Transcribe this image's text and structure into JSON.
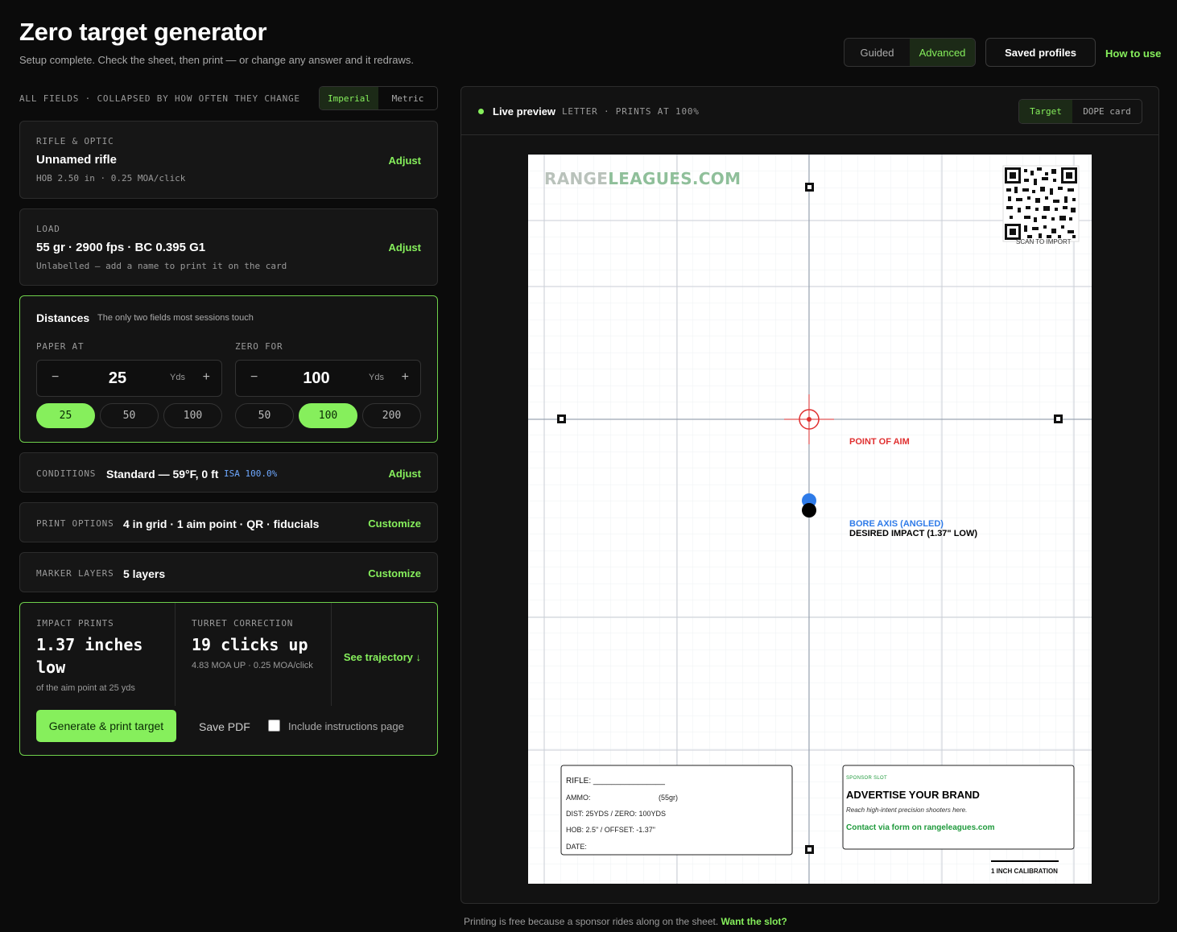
{
  "header": {
    "title": "Zero target generator",
    "subtitle": "Setup complete. Check the sheet, then print — or change any answer and it redraws.",
    "modes": [
      "Guided",
      "Advanced"
    ],
    "active_mode": "Advanced",
    "saved_profiles_label": "Saved profiles",
    "how_to_label": "How to use"
  },
  "fields_header": {
    "caption": "ALL FIELDS · COLLAPSED BY HOW OFTEN THEY CHANGE",
    "units": [
      "Imperial",
      "Metric"
    ],
    "active_unit": "Imperial"
  },
  "rifle": {
    "label": "RIFLE & OPTIC",
    "name": "Unnamed rifle",
    "details": "HOB 2.50 in · 0.25 MOA/click",
    "action": "Adjust"
  },
  "load": {
    "label": "LOAD",
    "summary": "55 gr · 2900 fps · BC 0.395 G1",
    "details": "Unlabelled — add a name to print it on the card",
    "action": "Adjust"
  },
  "distances": {
    "title": "Distances",
    "hint": "The only two fields most sessions touch",
    "paper_at": {
      "label": "PAPER AT",
      "minus": "−",
      "value": "25",
      "unit": "Yds",
      "plus": "+",
      "presets": [
        "25",
        "50",
        "100"
      ],
      "active": "25"
    },
    "zero_for": {
      "label": "ZERO FOR",
      "minus": "−",
      "value": "100",
      "unit": "Yds",
      "plus": "+",
      "presets": [
        "50",
        "100",
        "200"
      ],
      "active": "100"
    }
  },
  "conditions": {
    "label": "CONDITIONS",
    "value": "Standard — 59°F, 0 ft",
    "badge": "ISA 100.0%",
    "badge_color": "#6ea8ff",
    "action": "Adjust"
  },
  "print_options": {
    "label": "PRINT OPTIONS",
    "value": "4 in grid · 1 aim point · QR · fiducials",
    "action": "Customize"
  },
  "marker_layers": {
    "label": "MARKER LAYERS",
    "value": "5 layers",
    "action": "Customize"
  },
  "results": {
    "impact_label": "IMPACT PRINTS",
    "impact_line1": "1.37 inches",
    "impact_line2": "low",
    "impact_note": "of the aim point at 25 yds",
    "turret_label": "TURRET CORRECTION",
    "turret_value": "19 clicks up",
    "turret_note": "4.83 MOA UP · 0.25 MOA/click",
    "trajectory_link": "See trajectory ↓",
    "generate_label": "Generate & print target",
    "save_pdf_label": "Save PDF",
    "include_instructions_label": "Include instructions page",
    "include_instructions_checked": false
  },
  "preview": {
    "live_label": "Live preview",
    "paper_label": "LETTER · PRINTS AT 100%",
    "views": [
      "Target",
      "DOPE card"
    ],
    "active_view": "Target"
  },
  "sheet": {
    "brand_part1": "RANGE",
    "brand_part2": "LEAGUES.COM",
    "qr_caption": "SCAN TO IMPORT",
    "poa_label": "POINT OF AIM",
    "bore_label": "BORE AXIS (ANGLED)",
    "impact_label": "DESIRED IMPACT (1.37\" LOW)",
    "card_rifle": "RIFLE: ________________",
    "card_ammo": "AMMO:",
    "card_ammo_value": "(55gr)",
    "card_dist": "DIST: 25YDS / ZERO: 100YDS",
    "card_hob": "HOB: 2.5\" / OFFSET: -1.37\"",
    "card_date": "DATE:",
    "sponsor_tag": "SPONSOR SLOT",
    "sponsor_title": "ADVERTISE YOUR BRAND",
    "sponsor_text": "Reach high-intent precision shooters here.",
    "sponsor_contact": "Contact via form on rangeleagues.com",
    "calibration_label": "1 INCH CALIBRATION",
    "colors": {
      "poa": "#e03030",
      "bore": "#2f7be8",
      "impact": "#000000",
      "brand": "#8fbf9a",
      "sponsor": "#1f9a3c"
    }
  },
  "footer": {
    "note": "Printing is free because a sponsor rides along on the sheet.",
    "cta": "Want the slot?"
  }
}
